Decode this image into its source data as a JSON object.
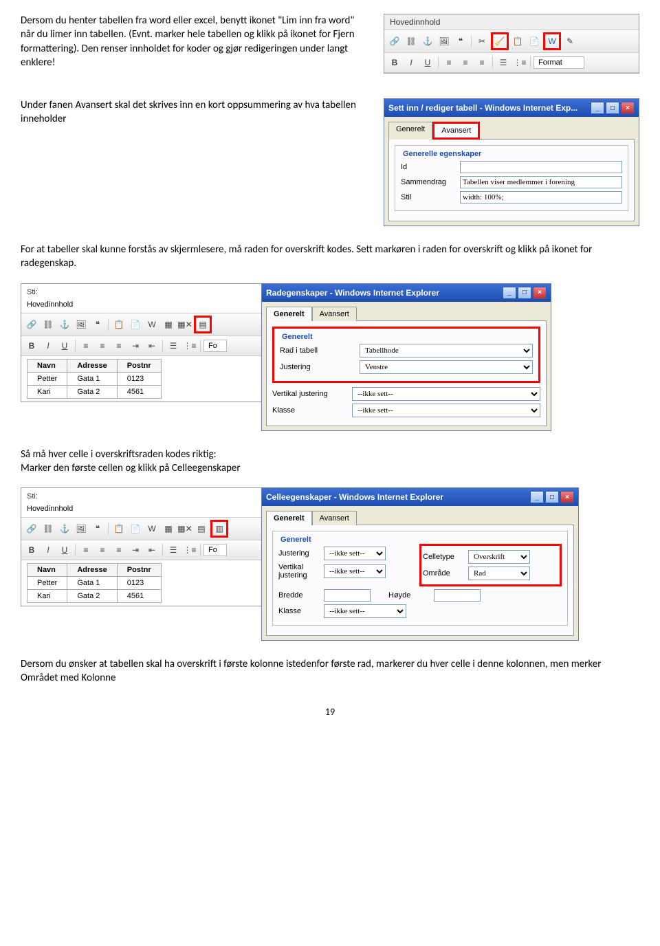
{
  "p1a": "Dersom du henter tabellen fra word eller excel, benytt ikonet \"Lim inn fra word\" når du limer inn tabellen. (Evnt. marker hele tabellen og klikk på ikonet for Fjern formattering). Den renser innholdet for koder og gjør redigeringen under langt enklere!",
  "p2": "Under fanen Avansert skal det skrives inn en kort oppsummering av hva tabellen inneholder",
  "p3": "For at tabeller skal kunne forstås av skjermlesere, må raden for overskrift kodes. Sett markøren i raden for overskrift og klikk på ikonet for radegenskap.",
  "p4": "Så må hver celle i overskriftsraden kodes riktig:",
  "p4b": "Marker den første cellen og klikk på Celleegenskaper",
  "p5": "Dersom du ønsker at tabellen skal ha overskrift i første kolonne istedenfor første rad, markerer du hver celle i denne kolonnen, men merker Området med Kolonne",
  "pagenum": "19",
  "editor1": {
    "title": "Hovedinnhold",
    "format": "Format"
  },
  "dlg1": {
    "title": "Sett inn / rediger tabell - Windows Internet Exp...",
    "tab1": "Generelt",
    "tab2": "Avansert",
    "group": "Generelle egenskaper",
    "id": "Id",
    "sammen": "Sammendrag",
    "sammen_v": "Tabellen viser medlemmer i forening",
    "stil": "Stil",
    "stil_v": "width: 100%;"
  },
  "ed2": {
    "sti": "Sti:",
    "hoved": "Hovedinnhold",
    "format": "Fo",
    "c1": "Navn",
    "c2": "Adresse",
    "c3": "Postnr",
    "r1": [
      "Petter",
      "Gata 1",
      "0123"
    ],
    "r2": [
      "Kari",
      "Gata 2",
      "4561"
    ]
  },
  "dlg2": {
    "title": "Radegenskaper - Windows Internet Explorer",
    "tab1": "Generelt",
    "tab2": "Avansert",
    "group": "Generelt",
    "rad": "Rad i tabell",
    "rad_v": "Tabellhode",
    "just": "Justering",
    "just_v": "Venstre",
    "vjust": "Vertikal justering",
    "vjust_v": "--ikke sett--",
    "klasse": "Klasse",
    "klasse_v": "--ikke sett--"
  },
  "dlg3": {
    "title": "Celleegenskaper - Windows Internet Explorer",
    "tab1": "Generelt",
    "tab2": "Avansert",
    "group": "Generelt",
    "just": "Justering",
    "just_v": "--ikke sett--",
    "ctype": "Celletype",
    "ctype_v": "Overskrift",
    "vjust": "Vertikal justering",
    "vjust_v": "--ikke sett--",
    "omr": "Område",
    "omr_v": "Rad",
    "bredde": "Bredde",
    "hoyde": "Høyde",
    "klasse": "Klasse",
    "klasse_v": "--ikke sett--"
  }
}
